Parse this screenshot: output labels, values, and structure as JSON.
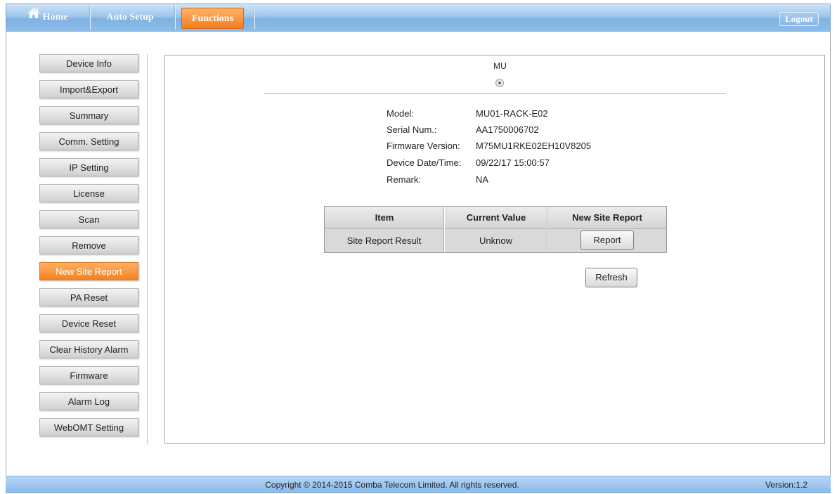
{
  "nav": {
    "home": "Home",
    "auto_setup": "Auto Setup",
    "functions": "Functions",
    "logout": "Logout",
    "home_icon": "home-icon",
    "accent_active": "#f4821f",
    "bar_color": "#8dbce8"
  },
  "sidebar": {
    "items": [
      "Device Info",
      "Import&Export",
      "Summary",
      "Comm. Setting",
      "IP Setting",
      "License",
      "Scan",
      "Remove",
      "New Site Report",
      "PA Reset",
      "Device Reset",
      "Clear History Alarm",
      "Firmware",
      "Alarm Log",
      "WebOMT Setting"
    ],
    "active": "New Site Report"
  },
  "device": {
    "selector_label": "MU",
    "info": [
      {
        "label": "Model:",
        "value": "MU01-RACK-E02"
      },
      {
        "label": "Serial Num.:",
        "value": "AA1750006702"
      },
      {
        "label": "Firmware Version:",
        "value": "M75MU1RKE02EH10V8205"
      },
      {
        "label": "Device Date/Time:",
        "value": "09/22/17 15:00:57"
      },
      {
        "label": "Remark:",
        "value": "NA"
      }
    ]
  },
  "report_table": {
    "headers": [
      "Item",
      "Current Value",
      "New Site Report"
    ],
    "row": {
      "item": "Site Report Result",
      "current_value": "Unknow",
      "button": "Report"
    }
  },
  "refresh_button": "Refresh",
  "footer": {
    "copyright": "Copyright © 2014-2015 Comba Telecom Limited. All rights reserved.",
    "version": "Version:1.2"
  }
}
